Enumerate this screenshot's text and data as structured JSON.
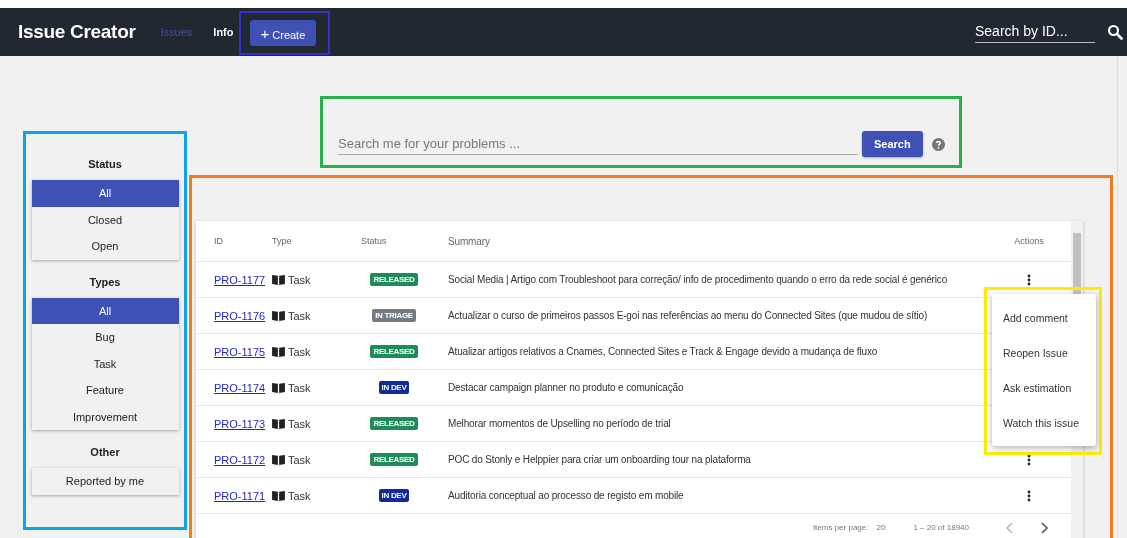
{
  "header": {
    "title": "Issue Creator",
    "nav": [
      {
        "label": "Issues",
        "selected": true
      },
      {
        "label": "Info",
        "selected": false
      }
    ],
    "create_button": {
      "icon": "+",
      "label": "Create"
    },
    "search": {
      "placeholder": "Search by ID..."
    }
  },
  "sidebar": {
    "groups": [
      {
        "title": "Status",
        "items": [
          {
            "label": "All",
            "selected": true
          },
          {
            "label": "Closed",
            "selected": false
          },
          {
            "label": "Open",
            "selected": false
          }
        ]
      },
      {
        "title": "Types",
        "items": [
          {
            "label": "All",
            "selected": true
          },
          {
            "label": "Bug",
            "selected": false
          },
          {
            "label": "Task",
            "selected": false
          },
          {
            "label": "Feature",
            "selected": false
          },
          {
            "label": "Improvement",
            "selected": false
          }
        ]
      },
      {
        "title": "Other",
        "items": [
          {
            "label": "Reported by me",
            "selected": false
          }
        ]
      }
    ]
  },
  "search": {
    "placeholder": "Search me for your problems ...",
    "button": "Search"
  },
  "table": {
    "columns": [
      "ID",
      "Type",
      "Status",
      "Summary",
      "Actions"
    ],
    "rows": [
      {
        "id": "PRO-1177",
        "type": "Task",
        "status": "RELEASED",
        "color": "#1e8c57",
        "summary": "Social Media | Artigo com Troubleshoot para correção/ info de procedimento quando o erro da rede social é genérico"
      },
      {
        "id": "PRO-1176",
        "type": "Task",
        "status": "IN TRIAGE",
        "color": "#757b85",
        "summary": "Actualizar o curso de primeiros passos E-goi nas referências ao menu do Connected Sites (que mudou de sítio)"
      },
      {
        "id": "PRO-1175",
        "type": "Task",
        "status": "RELEASED",
        "color": "#1e8c57",
        "summary": "Atualizar artigos relativos a Cnames, Connected Sites e Track & Engage devido a mudança de fluxo"
      },
      {
        "id": "PRO-1174",
        "type": "Task",
        "status": "IN DEV",
        "color": "#0f2b9e",
        "summary": "Destacar campaign planner no produto e comunicação"
      },
      {
        "id": "PRO-1173",
        "type": "Task",
        "status": "RELEASED",
        "color": "#1e8c57",
        "summary": "Melhorar momentos de Upselling no período de trial"
      },
      {
        "id": "PRO-1172",
        "type": "Task",
        "status": "RELEASED",
        "color": "#1e8c57",
        "summary": "POC do Stonly e Helppier para criar um onboarding tour na plataforma"
      },
      {
        "id": "PRO-1171",
        "type": "Task",
        "status": "IN DEV",
        "color": "#0f2b9e",
        "summary": "Auditoria conceptual ao processo de registo em mobile"
      }
    ],
    "paginator": {
      "items_per_page_label": "Items per page:",
      "items_per_page": "20",
      "range": "1 – 20 of 18940"
    }
  },
  "actions_menu": [
    "Add comment",
    "Reopen Issue",
    "Ask estimation",
    "Watch this issue"
  ]
}
